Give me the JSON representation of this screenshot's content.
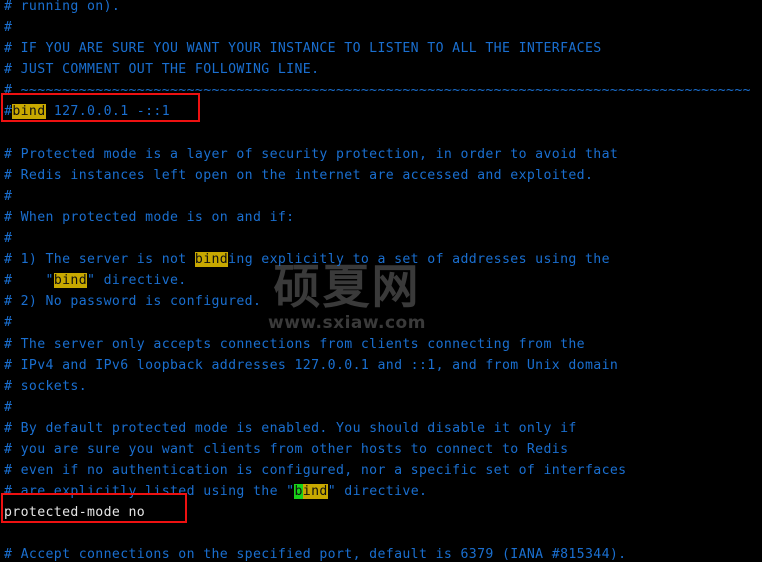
{
  "terminal": {
    "background_color": "#000000",
    "comment_color": "#1a6fd0",
    "plain_color": "#e6e6e6",
    "highlight_color": "#c8a800",
    "cursor_highlight_color": "#19d219",
    "annotation_box_color": "#ee1111",
    "file": "redis.conf"
  },
  "watermark": {
    "main": "硕夏网",
    "sub": "www.sxiaw.com",
    "color": "#3a3a3a"
  },
  "lines": [
    {
      "id": "l01",
      "text": "# running on)."
    },
    {
      "id": "l02",
      "text": "#"
    },
    {
      "id": "l03",
      "text": "# IF YOU ARE SURE YOU WANT YOUR INSTANCE TO LISTEN TO ALL THE INTERFACES"
    },
    {
      "id": "l04",
      "text": "# JUST COMMENT OUT THE FOLLOWING LINE."
    },
    {
      "id": "l05",
      "text": "# ~~~~~~~~~~~~~~~~~~~~~~~~~~~~~~~~~~~~~~~~~~~~~~~~~~~~~~~~~~~~~~~~~~~~~~~~~~~~~~~~~~~~~~~~"
    },
    {
      "id": "l06",
      "prefix": "#",
      "highlight": "bind",
      "suffix": " 127.0.0.1 -::1",
      "text": "#bind 127.0.0.1 -::1"
    },
    {
      "id": "l07",
      "text": ""
    },
    {
      "id": "l08",
      "text": "# Protected mode is a layer of security protection, in order to avoid that"
    },
    {
      "id": "l09",
      "text": "# Redis instances left open on the internet are accessed and exploited."
    },
    {
      "id": "l10",
      "text": "#"
    },
    {
      "id": "l11",
      "text": "# When protected mode is on and if:"
    },
    {
      "id": "l12",
      "text": "#"
    },
    {
      "id": "l13",
      "prefix": "# 1) The server is not ",
      "highlight": "bind",
      "suffix": "ing explicitly to a set of addresses using the",
      "text": "# 1) The server is not binding explicitly to a set of addresses using the"
    },
    {
      "id": "l14",
      "prefix": "#    \"",
      "highlight": "bind",
      "suffix": "\" directive.",
      "text": "#    \"bind\" directive."
    },
    {
      "id": "l15",
      "text": "# 2) No password is configured."
    },
    {
      "id": "l16",
      "text": "#"
    },
    {
      "id": "l17",
      "text": "# The server only accepts connections from clients connecting from the"
    },
    {
      "id": "l18",
      "text": "# IPv4 and IPv6 loopback addresses 127.0.0.1 and ::1, and from Unix domain"
    },
    {
      "id": "l19",
      "text": "# sockets."
    },
    {
      "id": "l20",
      "text": "#"
    },
    {
      "id": "l21",
      "text": "# By default protected mode is enabled. You should disable it only if"
    },
    {
      "id": "l22",
      "text": "# you are sure you want clients from other hosts to connect to Redis"
    },
    {
      "id": "l23",
      "text": "# even if no authentication is configured, nor a specific set of interfaces"
    },
    {
      "id": "l24",
      "prefix": "# are explicitly listed using the \"",
      "cursor": "b",
      "highlight": "ind",
      "suffix": "\" directive.",
      "text": "# are explicitly listed using the \"bind\" directive."
    },
    {
      "id": "l25",
      "text": "protected-mode no"
    },
    {
      "id": "l26",
      "text": ""
    },
    {
      "id": "l27",
      "text": "# Accept connections on the specified port, default is 6379 (IANA #815344)."
    }
  ],
  "annotations": [
    {
      "id": "redbox-bind",
      "target": "#bind 127.0.0.1 -::1"
    },
    {
      "id": "redbox-protected",
      "target": "protected-mode no"
    }
  ]
}
